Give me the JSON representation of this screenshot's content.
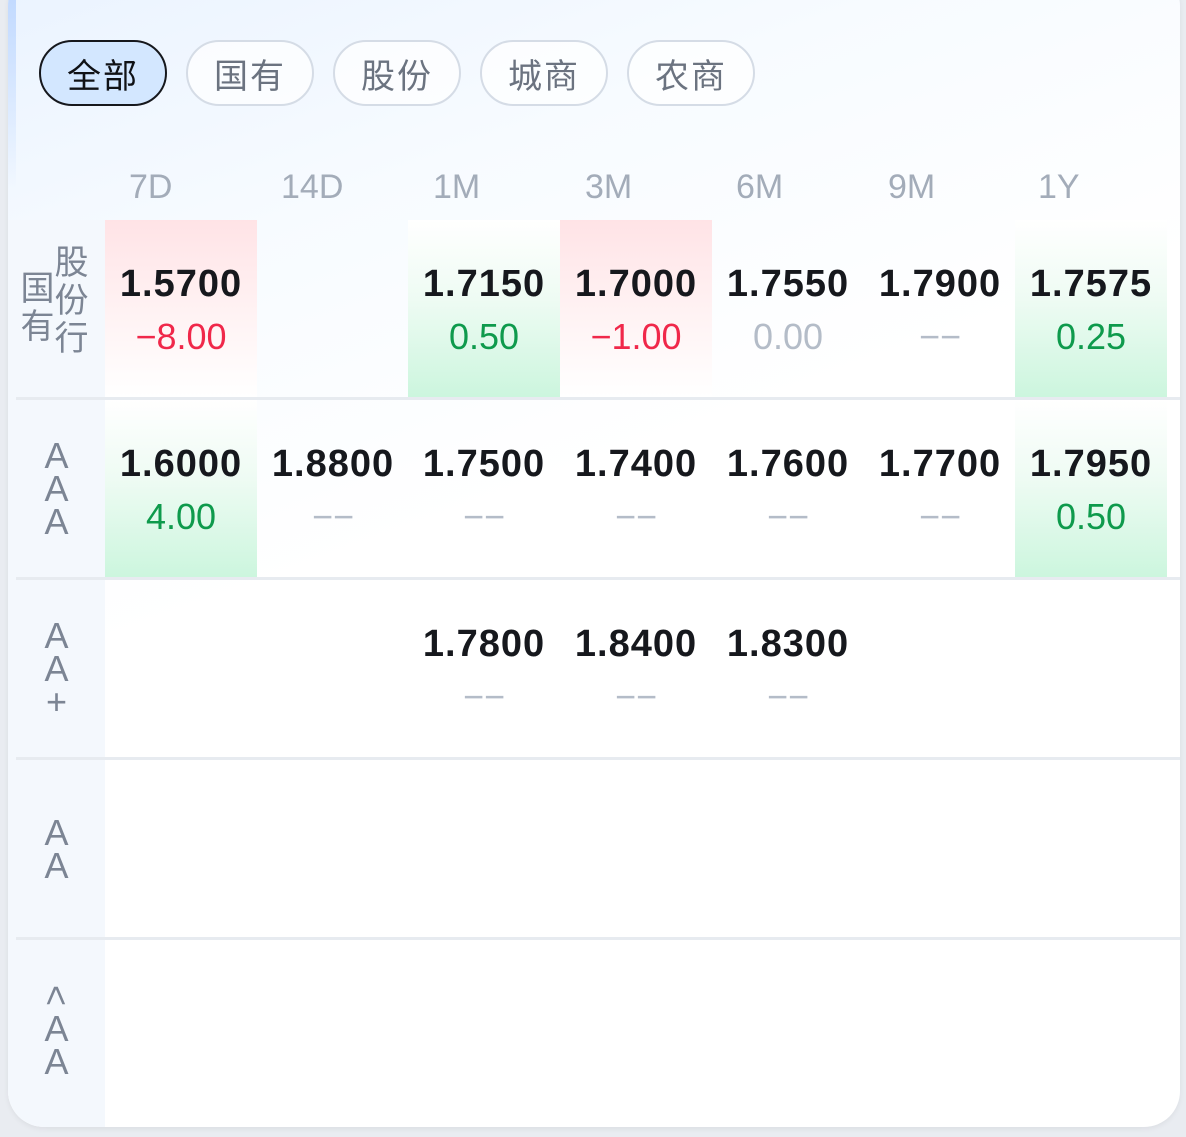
{
  "filters": [
    {
      "label": "全部",
      "active": true
    },
    {
      "label": "国有",
      "active": false
    },
    {
      "label": "股份",
      "active": false
    },
    {
      "label": "城商",
      "active": false
    },
    {
      "label": "农商",
      "active": false
    }
  ],
  "columns": [
    "7D",
    "14D",
    "1M",
    "3M",
    "6M",
    "9M",
    "1Y"
  ],
  "rows": [
    {
      "label_parts": [
        "国有",
        "股份行"
      ],
      "cells": [
        {
          "rate": "1.5700",
          "change": "−8.00",
          "trend": "up"
        },
        {
          "rate": "",
          "change": "",
          "trend": "none"
        },
        {
          "rate": "1.7150",
          "change": "0.50",
          "trend": "down"
        },
        {
          "rate": "1.7000",
          "change": "−1.00",
          "trend": "up"
        },
        {
          "rate": "1.7550",
          "change": "0.00",
          "trend": "flat"
        },
        {
          "rate": "1.7900",
          "change": "−−",
          "trend": "flat"
        },
        {
          "rate": "1.7575",
          "change": "0.25",
          "trend": "down"
        }
      ]
    },
    {
      "label": "AAA",
      "cells": [
        {
          "rate": "1.6000",
          "change": "4.00",
          "trend": "down"
        },
        {
          "rate": "1.8800",
          "change": "−−",
          "trend": "flat"
        },
        {
          "rate": "1.7500",
          "change": "−−",
          "trend": "flat"
        },
        {
          "rate": "1.7400",
          "change": "−−",
          "trend": "flat"
        },
        {
          "rate": "1.7600",
          "change": "−−",
          "trend": "flat"
        },
        {
          "rate": "1.7700",
          "change": "−−",
          "trend": "flat"
        },
        {
          "rate": "1.7950",
          "change": "0.50",
          "trend": "down"
        }
      ]
    },
    {
      "label": "AA+",
      "cells": [
        {
          "rate": "",
          "change": "",
          "trend": "none"
        },
        {
          "rate": "",
          "change": "",
          "trend": "none"
        },
        {
          "rate": "1.7800",
          "change": "−−",
          "trend": "flat"
        },
        {
          "rate": "1.8400",
          "change": "−−",
          "trend": "flat"
        },
        {
          "rate": "1.8300",
          "change": "−−",
          "trend": "flat"
        },
        {
          "rate": "",
          "change": "",
          "trend": "none"
        },
        {
          "rate": "",
          "change": "",
          "trend": "none"
        }
      ]
    },
    {
      "label": "AA",
      "cells": [
        {
          "rate": "",
          "change": "",
          "trend": "none"
        },
        {
          "rate": "",
          "change": "",
          "trend": "none"
        },
        {
          "rate": "",
          "change": "",
          "trend": "none"
        },
        {
          "rate": "",
          "change": "",
          "trend": "none"
        },
        {
          "rate": "",
          "change": "",
          "trend": "none"
        },
        {
          "rate": "",
          "change": "",
          "trend": "none"
        },
        {
          "rate": "",
          "change": "",
          "trend": "none"
        }
      ]
    },
    {
      "label": "<AA",
      "cells": [
        {
          "rate": "",
          "change": "",
          "trend": "none"
        },
        {
          "rate": "",
          "change": "",
          "trend": "none"
        },
        {
          "rate": "",
          "change": "",
          "trend": "none"
        },
        {
          "rate": "",
          "change": "",
          "trend": "none"
        },
        {
          "rate": "",
          "change": "",
          "trend": "none"
        },
        {
          "rate": "",
          "change": "",
          "trend": "none"
        },
        {
          "rate": "",
          "change": "",
          "trend": "none"
        }
      ]
    }
  ],
  "colors": {
    "up": "#f0284a",
    "down": "#0e9a4c",
    "neutral": "#b4bcc8",
    "active_pill_bg": "#d3e7ff"
  }
}
